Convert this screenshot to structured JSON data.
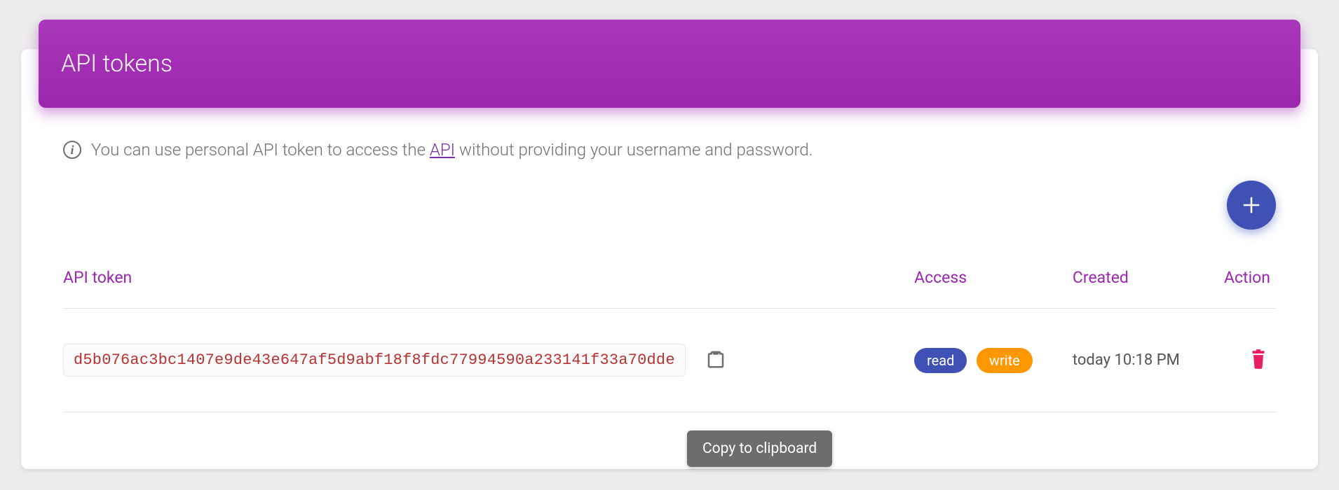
{
  "header": {
    "title": "API tokens"
  },
  "info": {
    "text_before": "You can use personal API token to access the ",
    "link_text": "API",
    "text_after": " without providing your username and password."
  },
  "fab": {
    "label": "Add token"
  },
  "table": {
    "headers": {
      "token": "API token",
      "access": "Access",
      "created": "Created",
      "action": "Action"
    },
    "row": {
      "token_value": "d5b076ac3bc1407e9de43e647af5d9abf18f8fdc77994590a233141f33a70dde",
      "access_read": "read",
      "access_write": "write",
      "created": "today 10:18 PM"
    }
  },
  "tooltip": {
    "copy": "Copy to clipboard"
  }
}
